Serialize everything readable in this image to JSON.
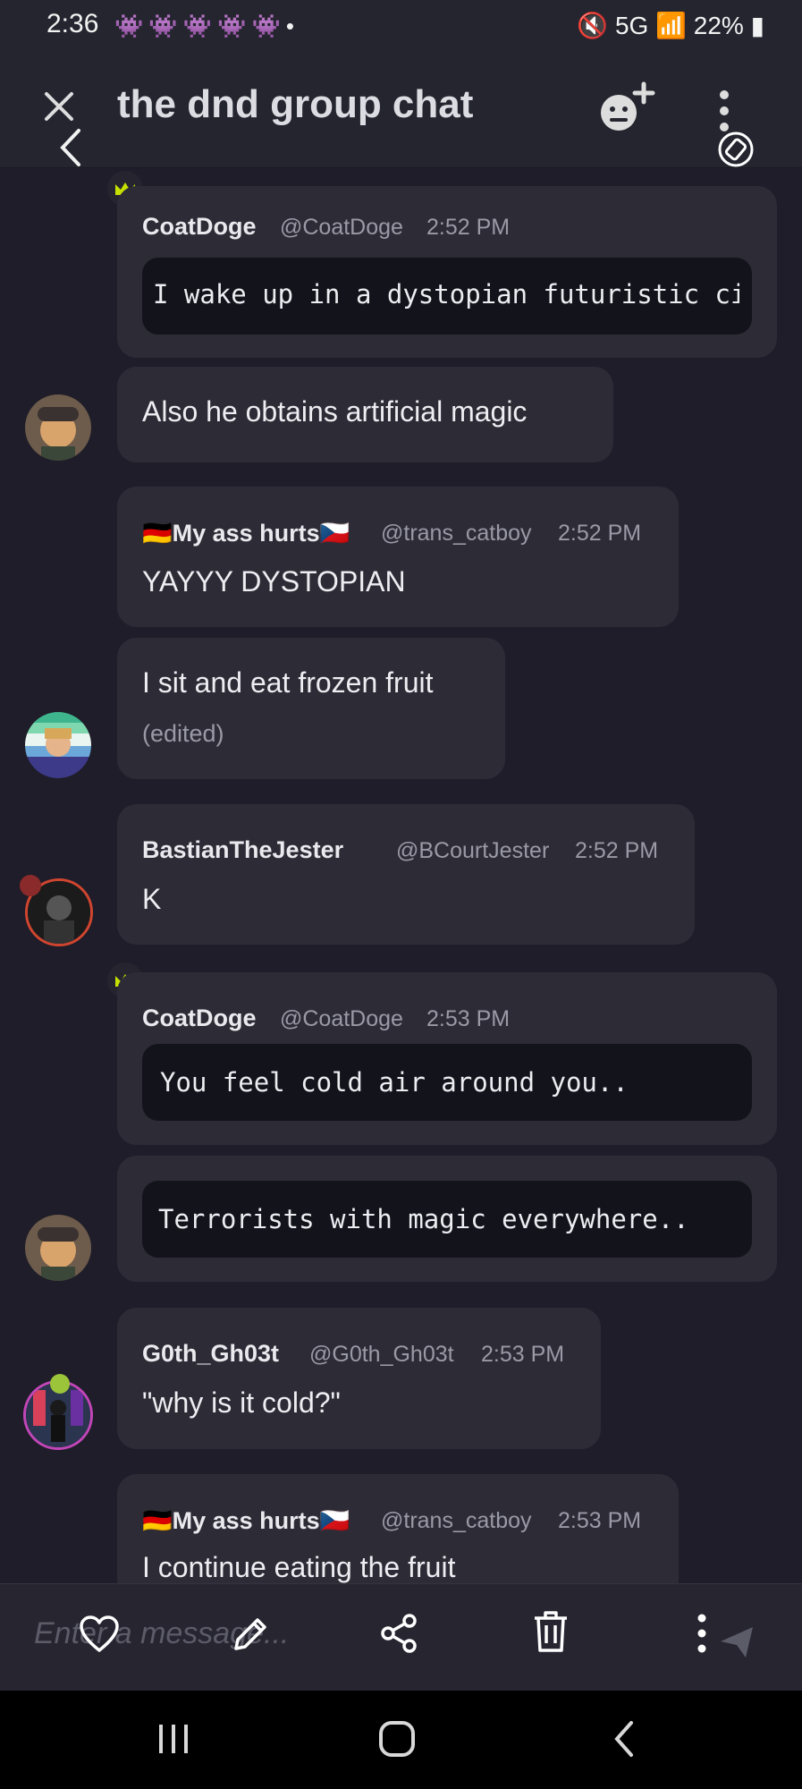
{
  "status_bar": {
    "time": "2:36",
    "network": "5G",
    "battery": "22%",
    "notification_icons": [
      "discord-icon",
      "discord-icon",
      "discord-icon",
      "discord-icon",
      "discord-icon",
      "dot-icon"
    ],
    "right_icons": [
      "mute-icon",
      "network-icon",
      "wifi-icon",
      "signal-icon",
      "battery-icon"
    ]
  },
  "header": {
    "title": "the dnd group chat",
    "icons": [
      "close-icon",
      "back-icon",
      "add-friend-icon",
      "more-icon",
      "focus-icon"
    ]
  },
  "messages": [
    {
      "author": "CoatDoge",
      "handle": "@CoatDoge",
      "time": "2:52 PM",
      "code": "I wake up in a dystopian futuristic city",
      "crown": true
    },
    {
      "text": "Also he obtains artificial magic"
    },
    {
      "author": "🇩🇪My ass hurts🇨🇿",
      "handle": "@trans_catboy",
      "time": "2:52 PM",
      "text": "YAYYY DYSTOPIAN"
    },
    {
      "text": "I sit and eat frozen fruit",
      "edited": "(edited)"
    },
    {
      "author": "BastianTheJester",
      "handle": "@BCourtJester",
      "time": "2:52 PM",
      "text": "K"
    },
    {
      "author": "CoatDoge",
      "handle": "@CoatDoge",
      "time": "2:53 PM",
      "code": "You feel cold air around you..",
      "crown": true
    },
    {
      "code": "Terrorists with magic everywhere.."
    },
    {
      "author": "G0th_Gh03t",
      "handle": "@G0th_Gh03t",
      "time": "2:53 PM",
      "text": "\"why is it cold?\""
    },
    {
      "author": "🇩🇪My ass hurts🇨🇿",
      "handle": "@trans_catboy",
      "time": "2:53 PM",
      "text": "I continue eating the fruit"
    }
  ],
  "input": {
    "placeholder": "Enter a message..."
  },
  "action_icons": [
    "heart-icon",
    "pencil-icon",
    "share-icon",
    "trash-icon",
    "more-vertical-icon",
    "send-icon"
  ],
  "colors": {
    "background": "#1e1d29",
    "bubble": "#2d2c36",
    "code_bg": "#13131b",
    "crown": "#c6e000",
    "muted": "#9a99a6"
  }
}
